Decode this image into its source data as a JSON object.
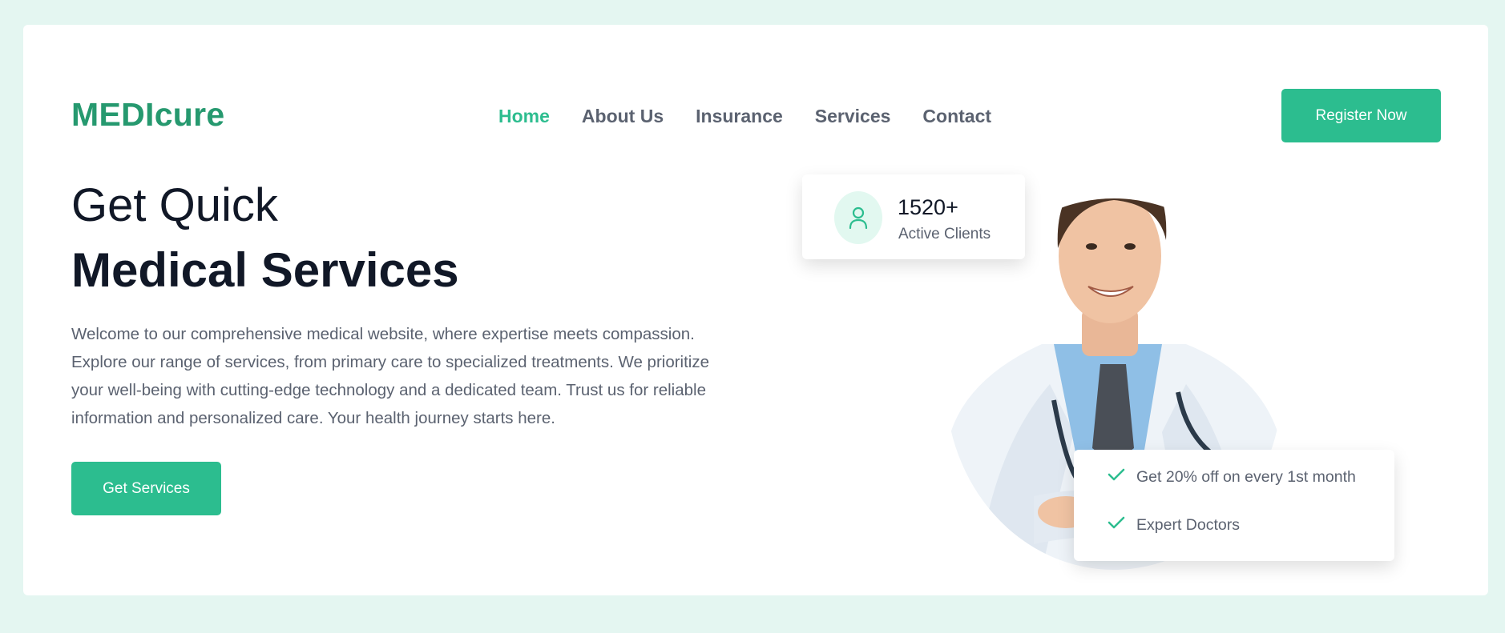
{
  "brand": {
    "logo": "MEDIcure",
    "accent": "#2cbd8f",
    "logo_color": "#26996f"
  },
  "nav": {
    "items": [
      {
        "label": "Home",
        "active": true
      },
      {
        "label": "About Us",
        "active": false
      },
      {
        "label": "Insurance",
        "active": false
      },
      {
        "label": "Services",
        "active": false
      },
      {
        "label": "Contact",
        "active": false
      }
    ],
    "cta_label": "Register Now"
  },
  "hero": {
    "title_line1": "Get Quick",
    "title_line2": "Medical Services",
    "description": "Welcome to our comprehensive medical website, where expertise meets compassion. Explore our range of services, from primary care to specialized treatments. We prioritize your well-being with cutting-edge technology and a dedicated team. Trust us for reliable information and personalized care. Your health journey starts here.",
    "cta_label": "Get Services"
  },
  "stats": {
    "icon": "user-icon",
    "value": "1520+",
    "label": "Active Clients"
  },
  "features": {
    "icon": "check-icon",
    "items": [
      "Get 20% off on every 1st month",
      "Expert Doctors"
    ]
  }
}
